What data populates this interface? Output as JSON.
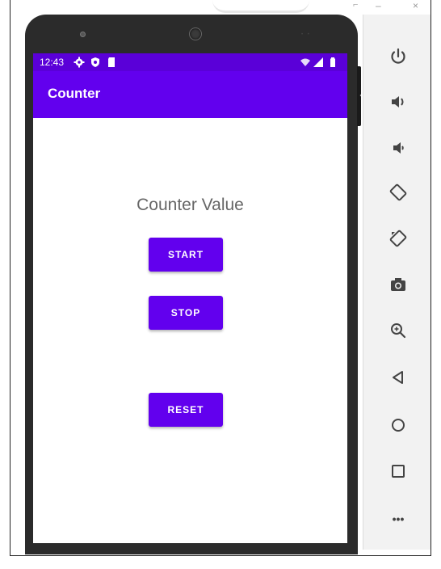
{
  "status_bar": {
    "time": "12:43",
    "icons_left": [
      "gear-icon",
      "shield-icon",
      "sd-card-icon"
    ],
    "icons_right": [
      "wifi-icon",
      "signal-icon",
      "battery-icon"
    ]
  },
  "app": {
    "title": "Counter",
    "counter_label": "Counter Value",
    "buttons": {
      "start": "START",
      "stop": "STOP",
      "reset": "RESET"
    }
  },
  "window_controls": {
    "minimize": "–",
    "close": "×"
  },
  "toolbar": {
    "items": [
      "power-icon",
      "volume-up-icon",
      "volume-down-icon",
      "rotate-left-icon",
      "rotate-right-icon",
      "camera-icon",
      "zoom-icon",
      "back-icon",
      "home-icon",
      "overview-icon",
      "more-icon"
    ],
    "more_label": "•••"
  },
  "colors": {
    "status_bar": "#5a00d8",
    "app_bar": "#6200ee",
    "button": "#6200ee",
    "phone_body": "#2b2b2b",
    "toolbar_bg": "#f2f2f2",
    "icon": "#444444"
  }
}
